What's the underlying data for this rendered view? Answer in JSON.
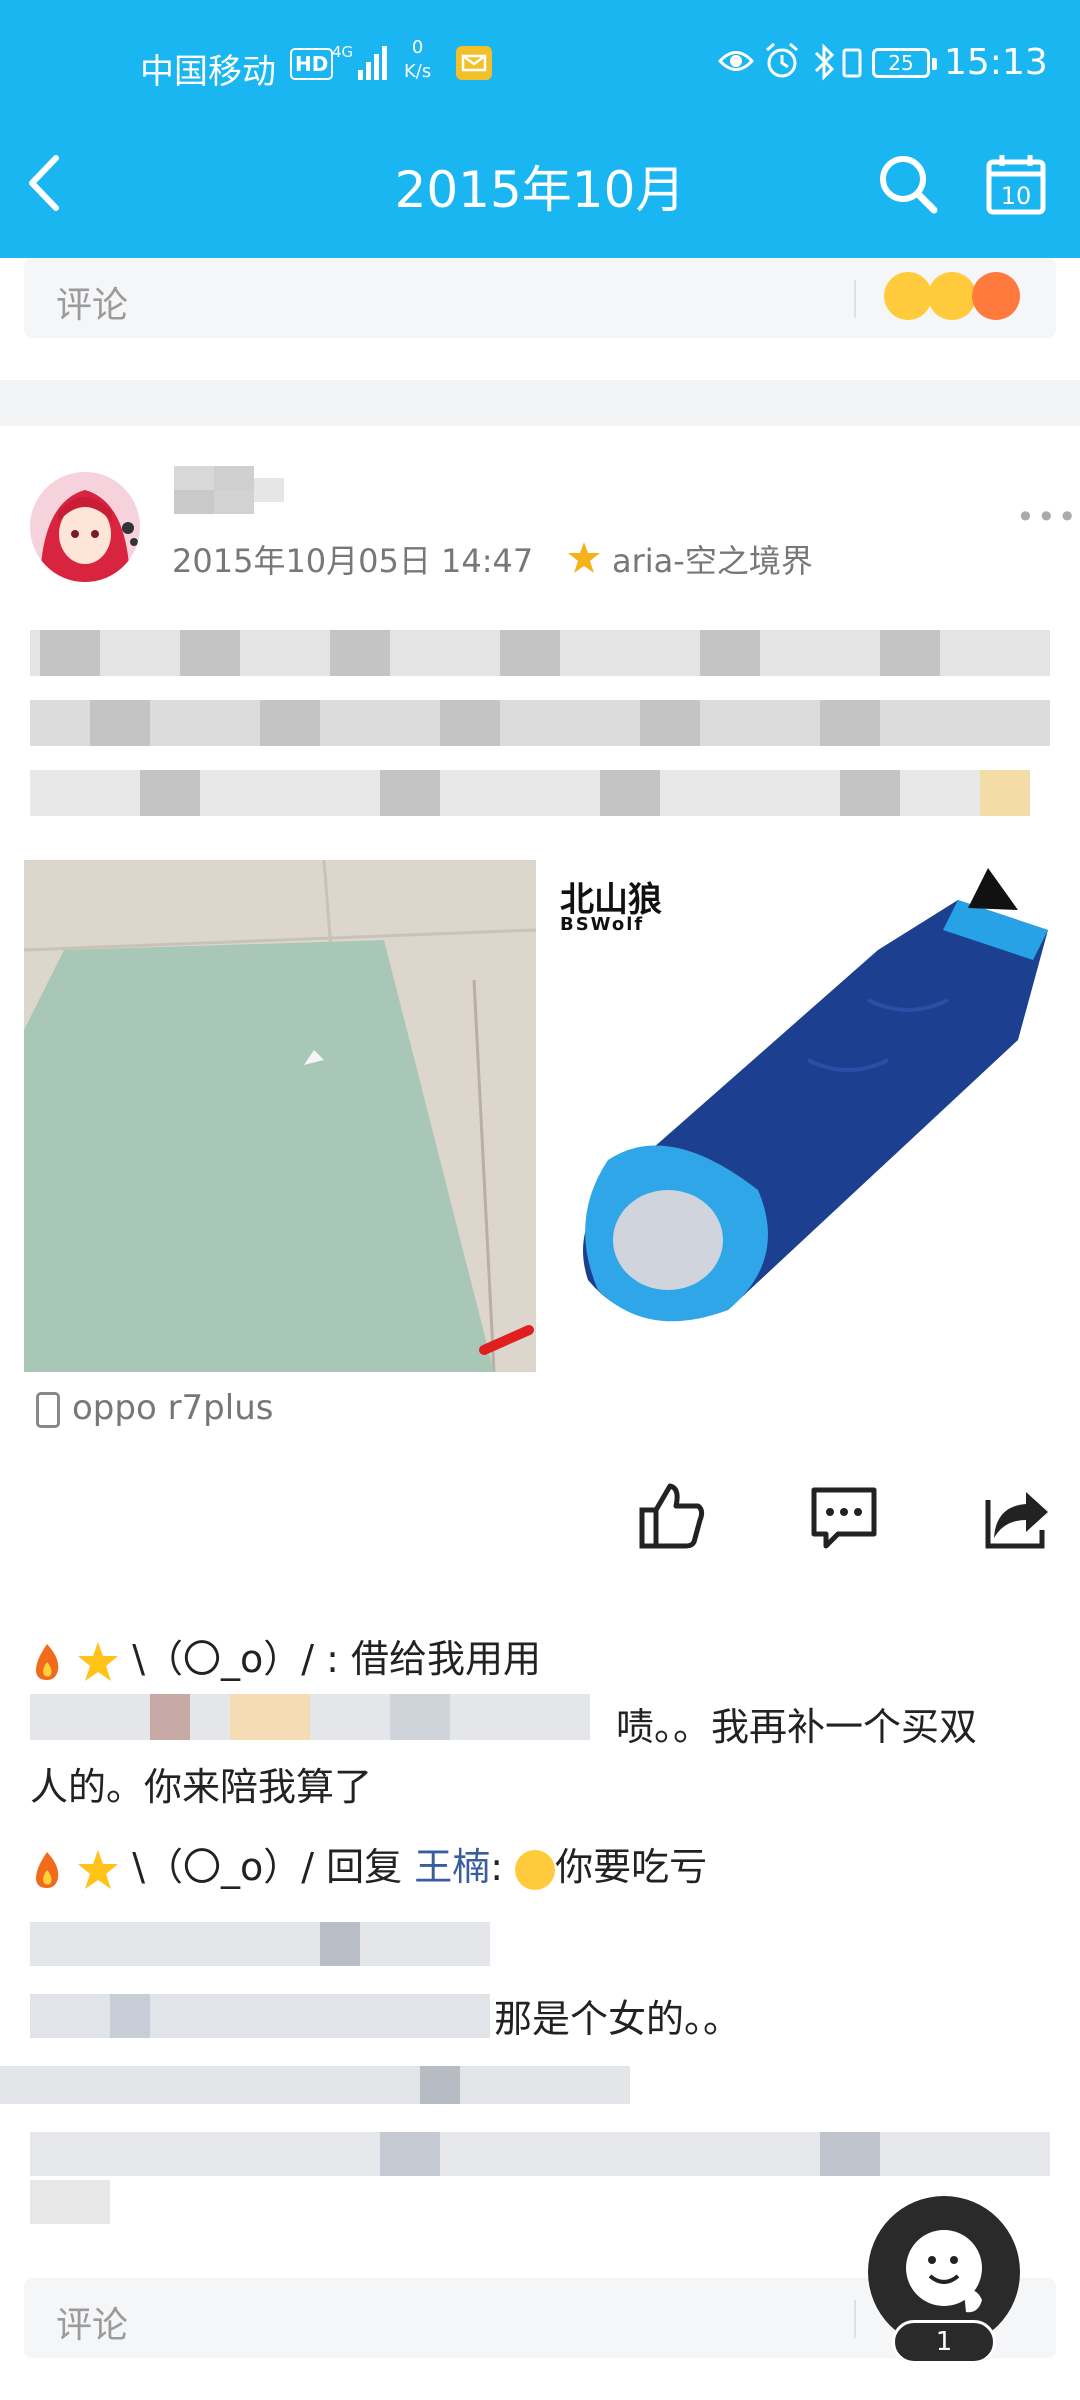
{
  "status_bar": {
    "carrier": "中国移动",
    "hd": "HD",
    "network": "4G",
    "speed_value": "0",
    "speed_unit": "K/s",
    "battery": "25",
    "time": "15:13"
  },
  "nav": {
    "title": "2015年10月",
    "calendar_day": "10"
  },
  "comment_box": {
    "placeholder": "评论"
  },
  "post": {
    "timestamp": "2015年10月05日 14:47",
    "source": "aria-空之境界",
    "more": "•••",
    "image2_brand": "北山狼",
    "image2_brand_sub": "BSWolf",
    "device": "oppo r7plus"
  },
  "comments": [
    {
      "prefix": "\\（〇_o）/",
      "text": ": 借给我用用"
    },
    {
      "text": "啧。。我再补一个买双"
    },
    {
      "text": "人的。你来陪我算了"
    },
    {
      "prefix": "\\（〇_o）/",
      "reply_label": "回复",
      "reply_to": "王楠",
      "text": "你要吃亏"
    },
    {
      "text": "那是个女的。。"
    }
  ],
  "floating": {
    "badge": "1"
  },
  "colors": {
    "header": "#1ab6f1",
    "link": "#3a5d9e"
  }
}
